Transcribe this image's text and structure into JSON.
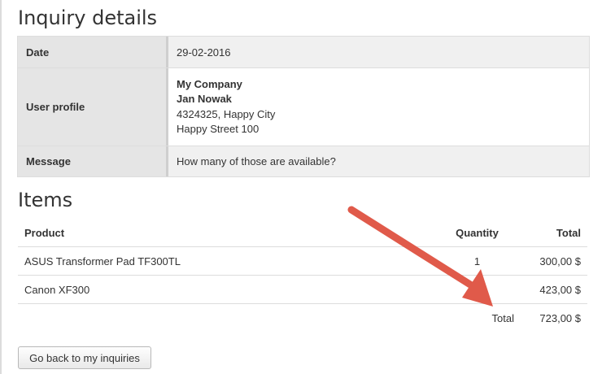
{
  "details": {
    "heading": "Inquiry details",
    "date_label": "Date",
    "date_value": "29-02-2016",
    "profile_label": "User profile",
    "profile_company": "My Company",
    "profile_name": "Jan Nowak",
    "profile_city": "4324325, Happy City",
    "profile_street": "Happy Street 100",
    "message_label": "Message",
    "message_value": "How many of those are available?"
  },
  "items": {
    "heading": "Items",
    "columns": [
      "Product",
      "Quantity",
      "Total"
    ],
    "rows": [
      {
        "product": "ASUS Transformer Pad TF300TL",
        "quantity": "1",
        "total": "300,00 $"
      },
      {
        "product": "Canon XF300",
        "quantity": "1",
        "total": "423,00 $"
      }
    ],
    "total_label": "Total",
    "total_value": "723,00 $"
  },
  "actions": {
    "back_label": "Go back to my inquiries"
  },
  "annotation": {
    "arrow_color": "#e05a4a"
  }
}
